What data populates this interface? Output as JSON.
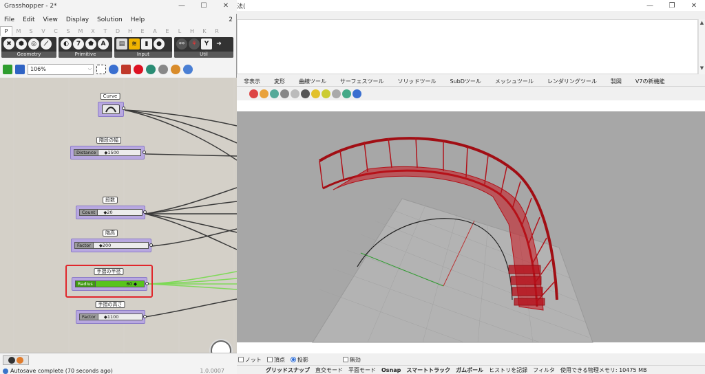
{
  "rhino": {
    "title_fragment": "法(",
    "toolbar_tabs": [
      "非表示",
      "変形",
      "曲線ツール",
      "サーフェスツール",
      "ソリッドツール",
      "SubDツール",
      "メッシュツール",
      "レンダリングツール",
      "製図",
      "V7の新機能"
    ],
    "snaps": [
      {
        "label": "ノット",
        "type": "checkbox"
      },
      {
        "label": "頂点",
        "type": "checkbox"
      },
      {
        "label": "投影",
        "type": "radio"
      },
      {
        "label": "無効",
        "type": "checkbox"
      }
    ],
    "status_items": [
      "グリッドスナップ",
      "直交モード",
      "平面モード",
      "Osnap",
      "スマートトラック",
      "ガムボール",
      "ヒストリを記録",
      "フィルタ",
      "使用できる物理メモリ: 10475 MB"
    ]
  },
  "grasshopper": {
    "title": "Grasshopper - 2*",
    "menu": [
      "File",
      "Edit",
      "View",
      "Display",
      "Solution",
      "Help"
    ],
    "menu_number": "2",
    "category_tabs": [
      "P",
      "M",
      "S",
      "V",
      "C",
      "S",
      "M",
      "X",
      "T",
      "D",
      "H",
      "E",
      "A",
      "E",
      "L",
      "H",
      "K",
      "R"
    ],
    "ribbon_panels": [
      {
        "label": "Geometry",
        "icons": [
          "✖",
          "⬢",
          "◎",
          "⟋"
        ]
      },
      {
        "label": "Primitive",
        "icons": [
          "◐",
          "7",
          "⬟",
          "A"
        ]
      },
      {
        "label": "Input",
        "icons": [
          "▤",
          "≋",
          "▮",
          "●"
        ]
      },
      {
        "label": "Util",
        "icons": [
          "⚯",
          "⚘",
          "Y",
          "➜"
        ]
      }
    ],
    "zoom_level": "106%",
    "components": {
      "curve": {
        "title": "Curve"
      },
      "stair_width": {
        "title": "階段の幅",
        "name": "Distance",
        "value": "◆1500"
      },
      "step_count": {
        "title": "段数",
        "name": "Count",
        "value": "◆20"
      },
      "stair_height": {
        "title": "階高",
        "name": "Factor",
        "value": "◆200"
      },
      "rail_radius": {
        "title": "手摺の半径",
        "name": "Radius",
        "value": "60 ◆"
      },
      "rail_height": {
        "title": "手摺の高さ",
        "name": "Factor",
        "value": "◆1100"
      }
    },
    "status_text": "Autosave complete (70 seconds ago)",
    "version": "1.0.0007"
  },
  "colors": {
    "selection_frame": "#e0262b",
    "green_wire": "#7ed957",
    "stair_red": "#c4161c",
    "component_purple": "#b8a8e0"
  }
}
